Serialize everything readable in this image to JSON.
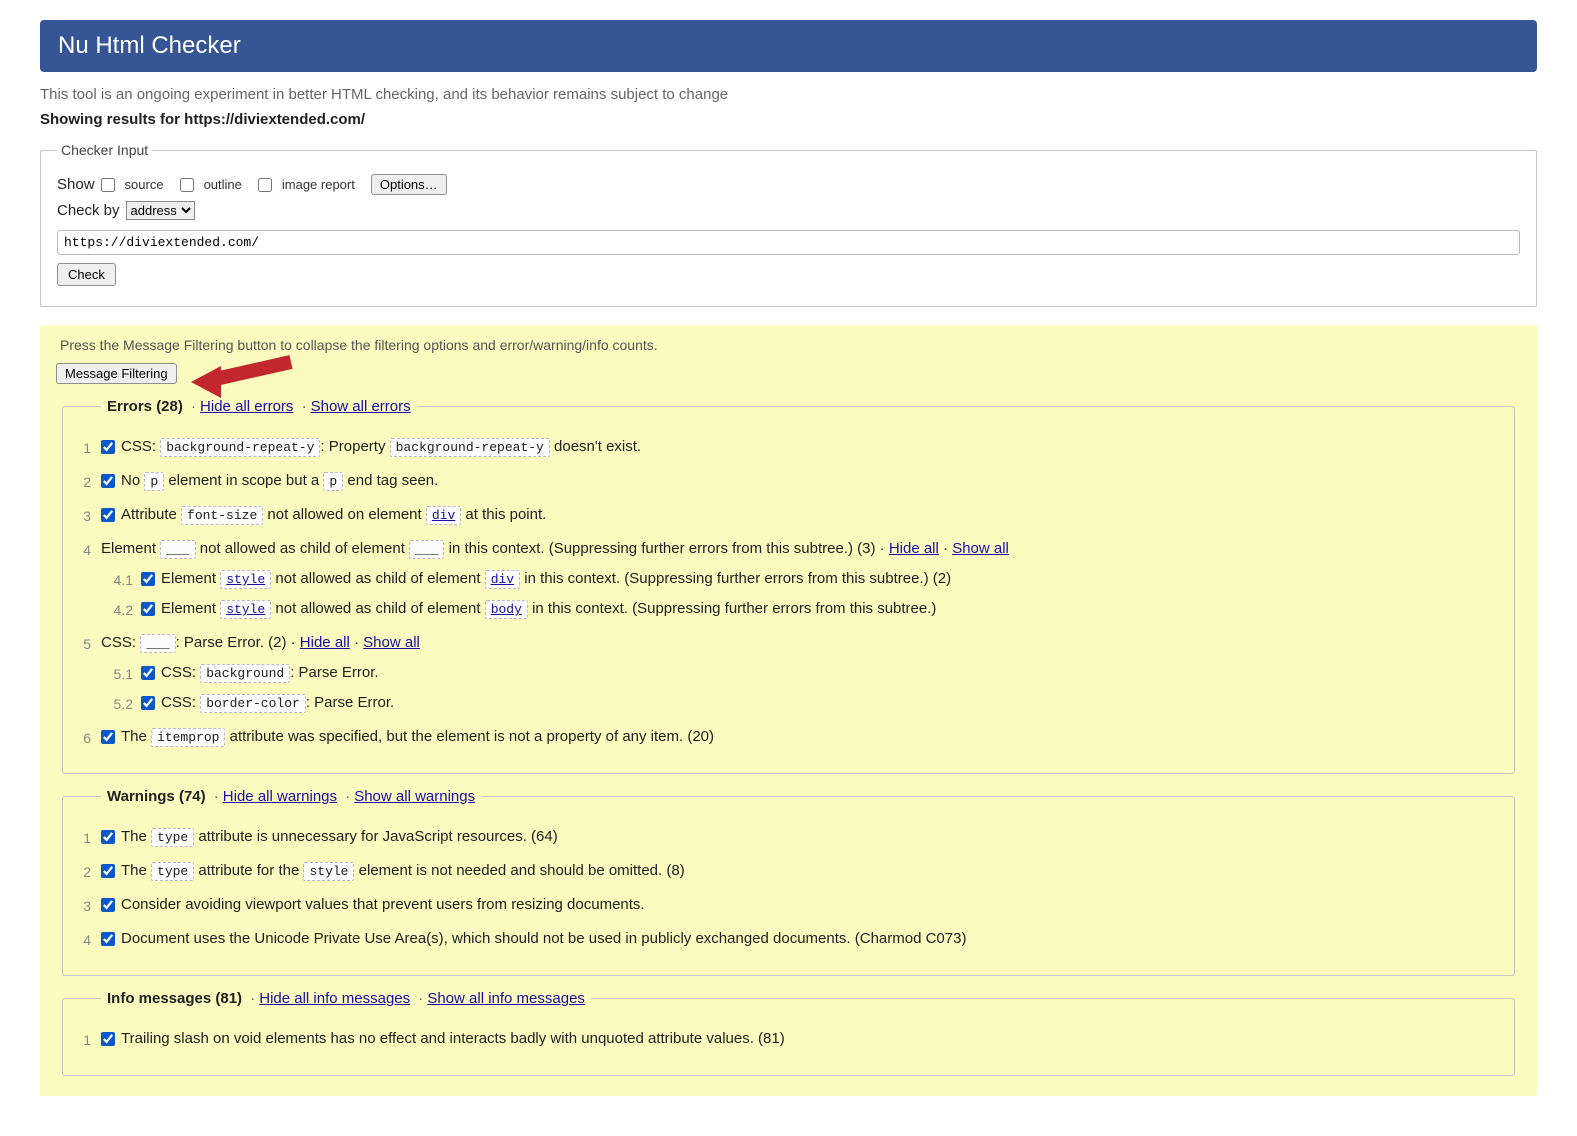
{
  "header": {
    "title": "Nu Html Checker"
  },
  "intro": "This tool is an ongoing experiment in better HTML checking, and its behavior remains subject to change",
  "showing": "Showing results for https://diviextended.com/",
  "checker": {
    "legend": "Checker Input",
    "show_label": "Show",
    "source_label": "source",
    "outline_label": "outline",
    "image_report_label": "image report",
    "options_label": "Options…",
    "check_by_label": "Check by",
    "check_by_value": "address",
    "url_value": "https://diviextended.com/",
    "check_button": "Check"
  },
  "hint": "Press the Message Filtering button to collapse the filtering options and error/warning/info counts.",
  "filter_button": "Message Filtering",
  "errors": {
    "title": "Errors (28)",
    "hide": "Hide all errors",
    "show": "Show all errors",
    "items": [
      {
        "parts": [
          {
            "t": "CSS: "
          },
          {
            "c": "background-repeat-y"
          },
          {
            "t": ": Property "
          },
          {
            "c": "background-repeat-y"
          },
          {
            "t": " doesn't exist."
          }
        ]
      },
      {
        "parts": [
          {
            "t": "No "
          },
          {
            "c": "p"
          },
          {
            "t": " element in scope but a "
          },
          {
            "c": "p"
          },
          {
            "t": " end tag seen."
          }
        ]
      },
      {
        "parts": [
          {
            "t": "Attribute "
          },
          {
            "c": "font-size"
          },
          {
            "t": " not allowed on element "
          },
          {
            "cl": "div"
          },
          {
            "t": " at this point."
          }
        ]
      },
      {
        "nocb": true,
        "parts": [
          {
            "t": "Element "
          },
          {
            "c": "___"
          },
          {
            "t": " not allowed as child of element "
          },
          {
            "c": "___"
          },
          {
            "t": " in this context. (Suppressing further errors from this subtree.) (3) · "
          },
          {
            "a": "Hide all"
          },
          {
            "t": " · "
          },
          {
            "a": "Show all"
          }
        ],
        "subs": [
          {
            "num": "4.1",
            "parts": [
              {
                "t": "Element "
              },
              {
                "cl": "style"
              },
              {
                "t": " not allowed as child of element "
              },
              {
                "cl": "div"
              },
              {
                "t": " in this context. (Suppressing further errors from this subtree.) (2)"
              }
            ]
          },
          {
            "num": "4.2",
            "parts": [
              {
                "t": "Element "
              },
              {
                "cl": "style"
              },
              {
                "t": " not allowed as child of element "
              },
              {
                "cl": "body"
              },
              {
                "t": " in this context. (Suppressing further errors from this subtree.)"
              }
            ]
          }
        ]
      },
      {
        "nocb": true,
        "parts": [
          {
            "t": "CSS: "
          },
          {
            "c": "___"
          },
          {
            "t": ": Parse Error. (2) · "
          },
          {
            "a": "Hide all"
          },
          {
            "t": " · "
          },
          {
            "a": "Show all"
          }
        ],
        "subs": [
          {
            "num": "5.1",
            "parts": [
              {
                "t": "CSS: "
              },
              {
                "c": "background"
              },
              {
                "t": ": Parse Error."
              }
            ]
          },
          {
            "num": "5.2",
            "parts": [
              {
                "t": "CSS: "
              },
              {
                "c": "border-color"
              },
              {
                "t": ": Parse Error."
              }
            ]
          }
        ]
      },
      {
        "parts": [
          {
            "t": "The "
          },
          {
            "c": "itemprop"
          },
          {
            "t": " attribute was specified, but the element is not a property of any item. (20)"
          }
        ]
      }
    ]
  },
  "warnings": {
    "title": "Warnings (74)",
    "hide": "Hide all warnings",
    "show": "Show all warnings",
    "items": [
      {
        "parts": [
          {
            "t": "The "
          },
          {
            "c": "type"
          },
          {
            "t": " attribute is unnecessary for JavaScript resources. (64)"
          }
        ]
      },
      {
        "parts": [
          {
            "t": "The "
          },
          {
            "c": "type"
          },
          {
            "t": " attribute for the "
          },
          {
            "c": "style"
          },
          {
            "t": " element is not needed and should be omitted. (8)"
          }
        ]
      },
      {
        "parts": [
          {
            "t": "Consider avoiding viewport values that prevent users from resizing documents."
          }
        ]
      },
      {
        "parts": [
          {
            "t": "Document uses the Unicode Private Use Area(s), which should not be used in publicly exchanged documents. (Charmod C073)"
          }
        ]
      }
    ]
  },
  "info": {
    "title": "Info messages (81)",
    "hide": "Hide all info messages",
    "show": "Show all info messages",
    "items": [
      {
        "parts": [
          {
            "t": "Trailing slash on void elements has no effect and interacts badly with unquoted attribute values. (81)"
          }
        ]
      }
    ]
  }
}
